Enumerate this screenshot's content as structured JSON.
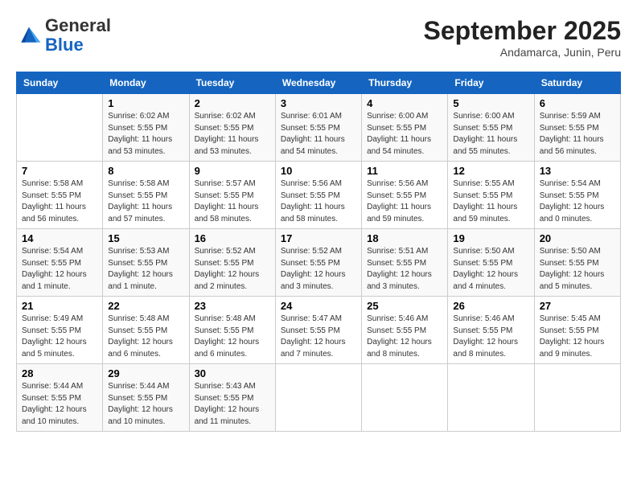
{
  "header": {
    "logo_general": "General",
    "logo_blue": "Blue",
    "month": "September 2025",
    "location": "Andamarca, Junin, Peru"
  },
  "weekdays": [
    "Sunday",
    "Monday",
    "Tuesday",
    "Wednesday",
    "Thursday",
    "Friday",
    "Saturday"
  ],
  "weeks": [
    [
      {
        "day": "",
        "info": ""
      },
      {
        "day": "1",
        "info": "Sunrise: 6:02 AM\nSunset: 5:55 PM\nDaylight: 11 hours\nand 53 minutes."
      },
      {
        "day": "2",
        "info": "Sunrise: 6:02 AM\nSunset: 5:55 PM\nDaylight: 11 hours\nand 53 minutes."
      },
      {
        "day": "3",
        "info": "Sunrise: 6:01 AM\nSunset: 5:55 PM\nDaylight: 11 hours\nand 54 minutes."
      },
      {
        "day": "4",
        "info": "Sunrise: 6:00 AM\nSunset: 5:55 PM\nDaylight: 11 hours\nand 54 minutes."
      },
      {
        "day": "5",
        "info": "Sunrise: 6:00 AM\nSunset: 5:55 PM\nDaylight: 11 hours\nand 55 minutes."
      },
      {
        "day": "6",
        "info": "Sunrise: 5:59 AM\nSunset: 5:55 PM\nDaylight: 11 hours\nand 56 minutes."
      }
    ],
    [
      {
        "day": "7",
        "info": "Sunrise: 5:58 AM\nSunset: 5:55 PM\nDaylight: 11 hours\nand 56 minutes."
      },
      {
        "day": "8",
        "info": "Sunrise: 5:58 AM\nSunset: 5:55 PM\nDaylight: 11 hours\nand 57 minutes."
      },
      {
        "day": "9",
        "info": "Sunrise: 5:57 AM\nSunset: 5:55 PM\nDaylight: 11 hours\nand 58 minutes."
      },
      {
        "day": "10",
        "info": "Sunrise: 5:56 AM\nSunset: 5:55 PM\nDaylight: 11 hours\nand 58 minutes."
      },
      {
        "day": "11",
        "info": "Sunrise: 5:56 AM\nSunset: 5:55 PM\nDaylight: 11 hours\nand 59 minutes."
      },
      {
        "day": "12",
        "info": "Sunrise: 5:55 AM\nSunset: 5:55 PM\nDaylight: 11 hours\nand 59 minutes."
      },
      {
        "day": "13",
        "info": "Sunrise: 5:54 AM\nSunset: 5:55 PM\nDaylight: 12 hours\nand 0 minutes."
      }
    ],
    [
      {
        "day": "14",
        "info": "Sunrise: 5:54 AM\nSunset: 5:55 PM\nDaylight: 12 hours\nand 1 minute."
      },
      {
        "day": "15",
        "info": "Sunrise: 5:53 AM\nSunset: 5:55 PM\nDaylight: 12 hours\nand 1 minute."
      },
      {
        "day": "16",
        "info": "Sunrise: 5:52 AM\nSunset: 5:55 PM\nDaylight: 12 hours\nand 2 minutes."
      },
      {
        "day": "17",
        "info": "Sunrise: 5:52 AM\nSunset: 5:55 PM\nDaylight: 12 hours\nand 3 minutes."
      },
      {
        "day": "18",
        "info": "Sunrise: 5:51 AM\nSunset: 5:55 PM\nDaylight: 12 hours\nand 3 minutes."
      },
      {
        "day": "19",
        "info": "Sunrise: 5:50 AM\nSunset: 5:55 PM\nDaylight: 12 hours\nand 4 minutes."
      },
      {
        "day": "20",
        "info": "Sunrise: 5:50 AM\nSunset: 5:55 PM\nDaylight: 12 hours\nand 5 minutes."
      }
    ],
    [
      {
        "day": "21",
        "info": "Sunrise: 5:49 AM\nSunset: 5:55 PM\nDaylight: 12 hours\nand 5 minutes."
      },
      {
        "day": "22",
        "info": "Sunrise: 5:48 AM\nSunset: 5:55 PM\nDaylight: 12 hours\nand 6 minutes."
      },
      {
        "day": "23",
        "info": "Sunrise: 5:48 AM\nSunset: 5:55 PM\nDaylight: 12 hours\nand 6 minutes."
      },
      {
        "day": "24",
        "info": "Sunrise: 5:47 AM\nSunset: 5:55 PM\nDaylight: 12 hours\nand 7 minutes."
      },
      {
        "day": "25",
        "info": "Sunrise: 5:46 AM\nSunset: 5:55 PM\nDaylight: 12 hours\nand 8 minutes."
      },
      {
        "day": "26",
        "info": "Sunrise: 5:46 AM\nSunset: 5:55 PM\nDaylight: 12 hours\nand 8 minutes."
      },
      {
        "day": "27",
        "info": "Sunrise: 5:45 AM\nSunset: 5:55 PM\nDaylight: 12 hours\nand 9 minutes."
      }
    ],
    [
      {
        "day": "28",
        "info": "Sunrise: 5:44 AM\nSunset: 5:55 PM\nDaylight: 12 hours\nand 10 minutes."
      },
      {
        "day": "29",
        "info": "Sunrise: 5:44 AM\nSunset: 5:55 PM\nDaylight: 12 hours\nand 10 minutes."
      },
      {
        "day": "30",
        "info": "Sunrise: 5:43 AM\nSunset: 5:55 PM\nDaylight: 12 hours\nand 11 minutes."
      },
      {
        "day": "",
        "info": ""
      },
      {
        "day": "",
        "info": ""
      },
      {
        "day": "",
        "info": ""
      },
      {
        "day": "",
        "info": ""
      }
    ]
  ]
}
